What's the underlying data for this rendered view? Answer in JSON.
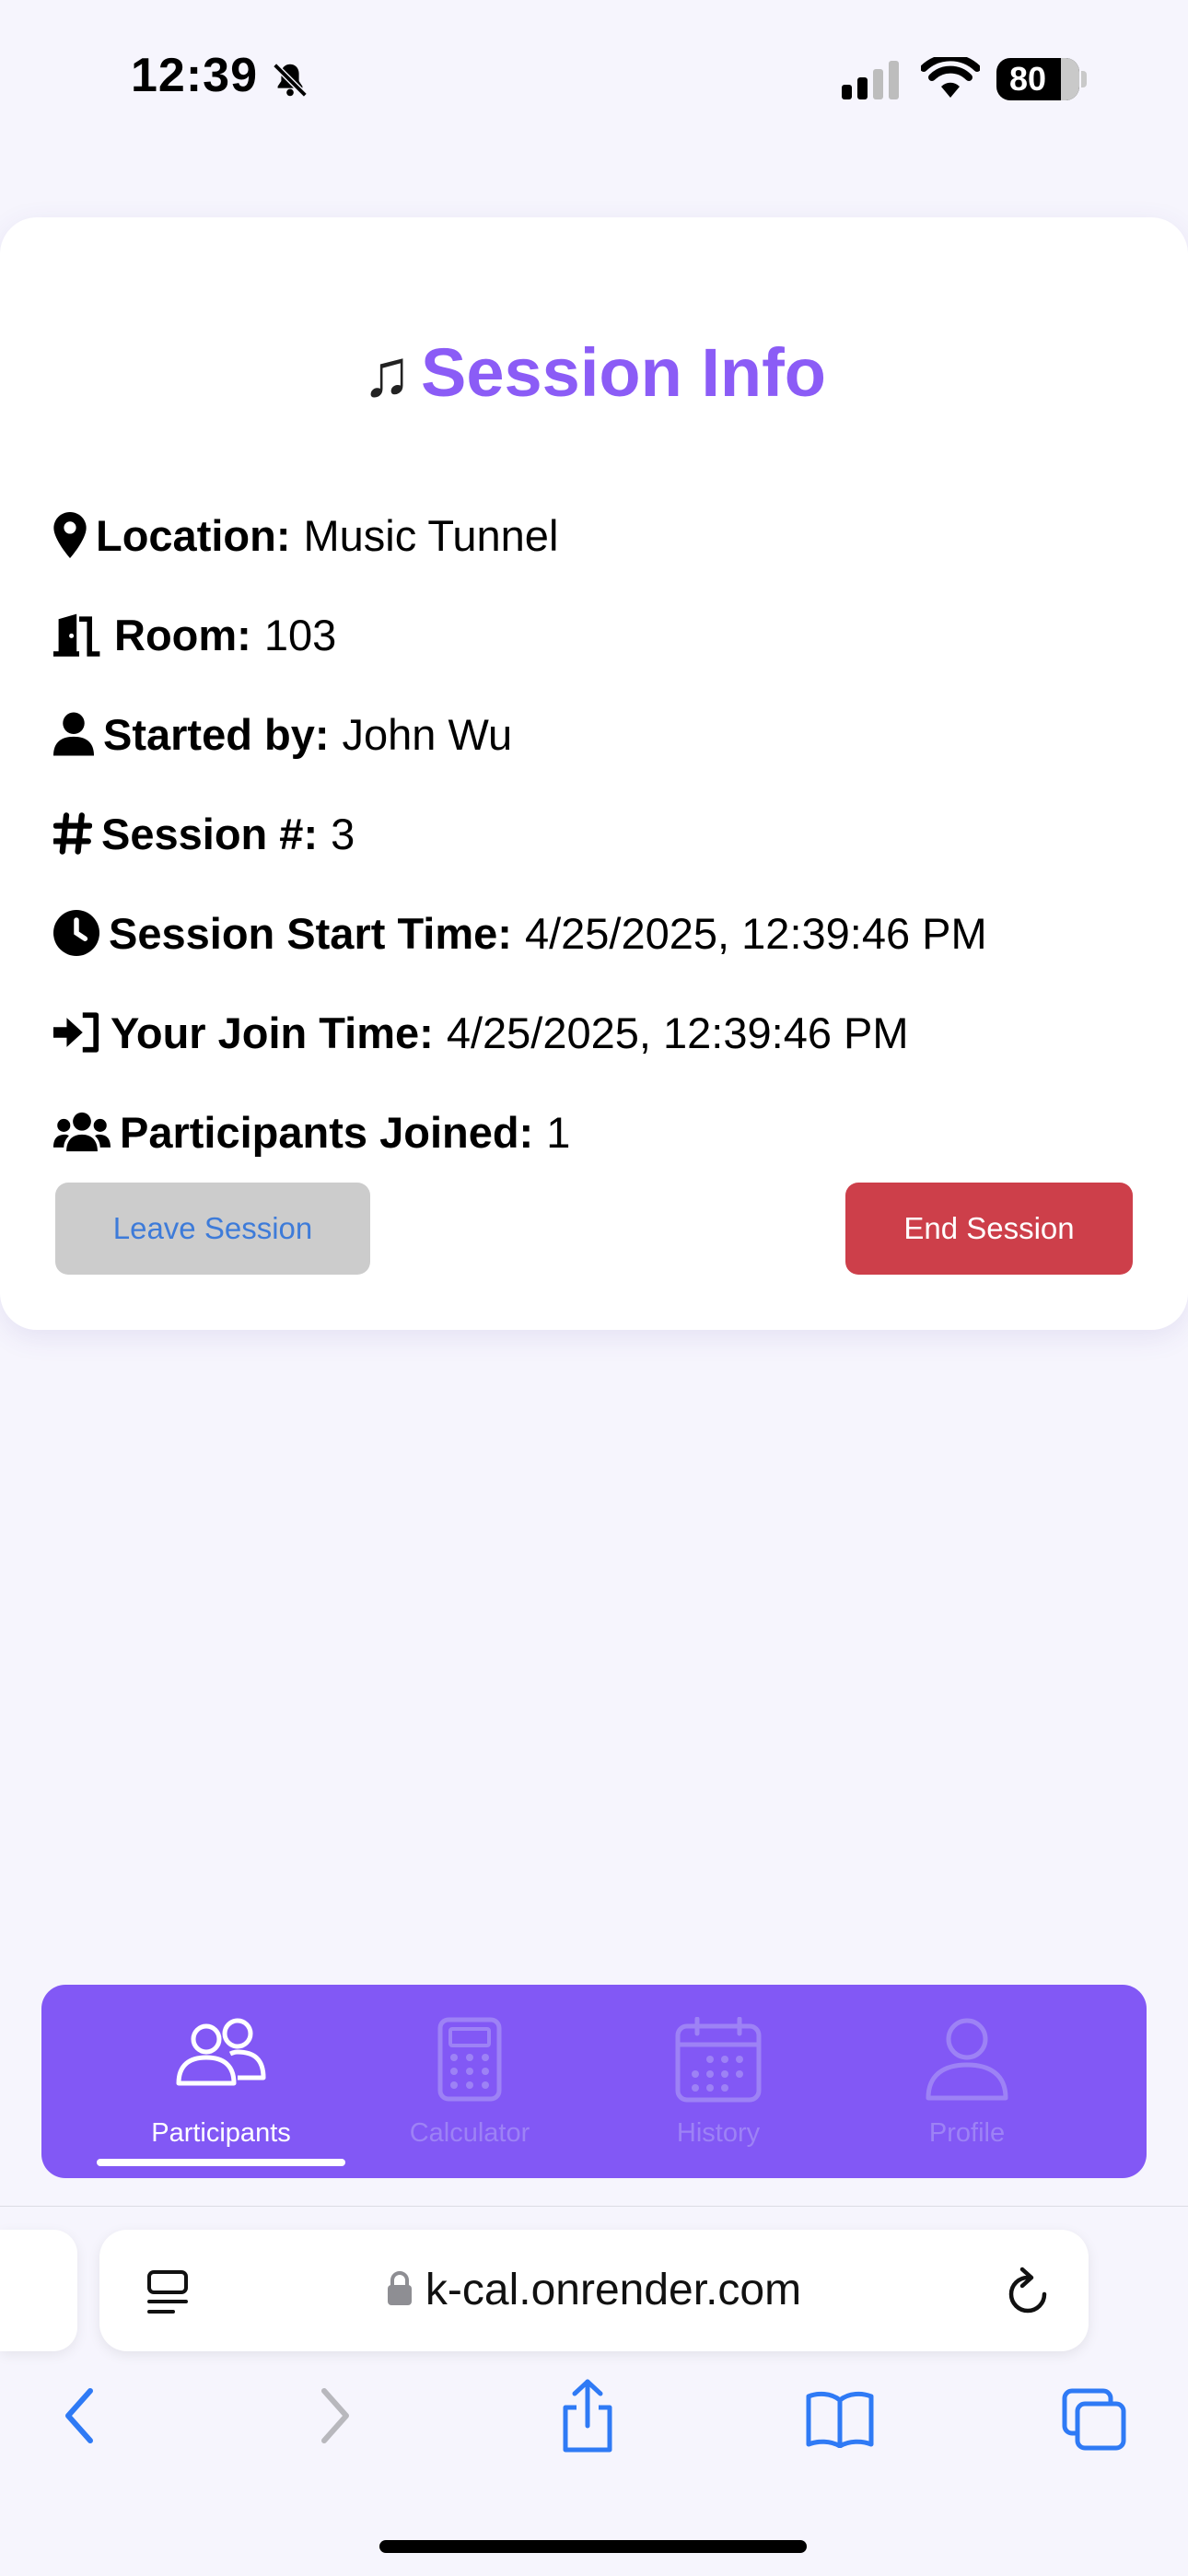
{
  "status": {
    "time": "12:39",
    "battery": "80"
  },
  "session": {
    "title": "Session Info",
    "rows": [
      {
        "label": "Location:",
        "value": "Music Tunnel"
      },
      {
        "label": "Room:",
        "value": "103"
      },
      {
        "label": "Started by:",
        "value": "John Wu"
      },
      {
        "label": "Session #:",
        "value": "3"
      },
      {
        "label": "Session Start Time:",
        "value": "4/25/2025, 12:39:46 PM"
      },
      {
        "label": "Your Join Time:",
        "value": "4/25/2025, 12:39:46 PM"
      },
      {
        "label": "Participants Joined:",
        "value": "1"
      }
    ],
    "leave_label": "Leave Session",
    "end_label": "End Session"
  },
  "nav": {
    "items": [
      {
        "label": "Participants",
        "icon": "users-icon",
        "active": true
      },
      {
        "label": "Calculator",
        "icon": "calculator-icon",
        "active": false
      },
      {
        "label": "History",
        "icon": "calendar-icon",
        "active": false
      },
      {
        "label": "Profile",
        "icon": "user-icon",
        "active": false
      }
    ]
  },
  "browser": {
    "url": "k-cal.onrender.com"
  },
  "colors": {
    "accent": "#8b5cf6",
    "nav_bg": "#8258f5",
    "end_button": "#cd3f4a",
    "leave_button": "#cccccc"
  }
}
